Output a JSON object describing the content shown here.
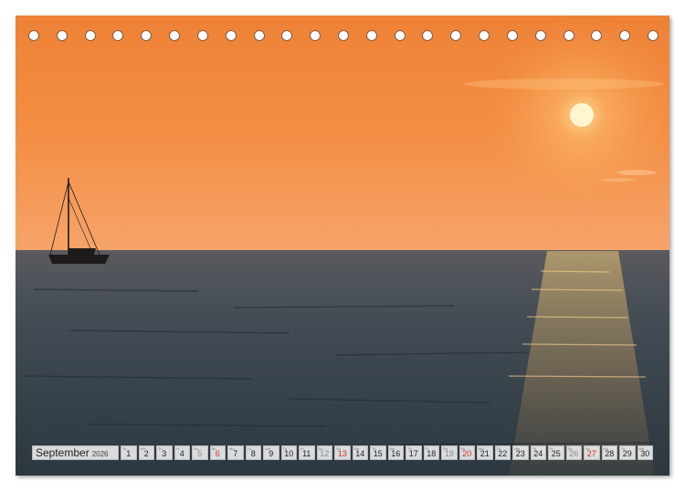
{
  "calendar": {
    "month": "September",
    "year": "2026",
    "days": [
      {
        "n": "1",
        "wd": "Tu",
        "type": "weekday"
      },
      {
        "n": "2",
        "wd": "We",
        "type": "weekday"
      },
      {
        "n": "3",
        "wd": "Th",
        "type": "weekday"
      },
      {
        "n": "4",
        "wd": "Fr",
        "type": "weekday"
      },
      {
        "n": "5",
        "wd": "Sa",
        "type": "sat"
      },
      {
        "n": "6",
        "wd": "Su",
        "type": "sun"
      },
      {
        "n": "7",
        "wd": "Mo",
        "type": "weekday"
      },
      {
        "n": "8",
        "wd": "Tu",
        "type": "weekday"
      },
      {
        "n": "9",
        "wd": "We",
        "type": "weekday"
      },
      {
        "n": "10",
        "wd": "Th",
        "type": "weekday"
      },
      {
        "n": "11",
        "wd": "Fr",
        "type": "weekday"
      },
      {
        "n": "12",
        "wd": "Sa",
        "type": "sat"
      },
      {
        "n": "13",
        "wd": "Su",
        "type": "sun"
      },
      {
        "n": "14",
        "wd": "Mo",
        "type": "weekday"
      },
      {
        "n": "15",
        "wd": "Tu",
        "type": "weekday"
      },
      {
        "n": "16",
        "wd": "We",
        "type": "weekday"
      },
      {
        "n": "17",
        "wd": "Th",
        "type": "weekday"
      },
      {
        "n": "18",
        "wd": "Fr",
        "type": "weekday"
      },
      {
        "n": "19",
        "wd": "Sa",
        "type": "sat"
      },
      {
        "n": "20",
        "wd": "Su",
        "type": "sun"
      },
      {
        "n": "21",
        "wd": "Mo",
        "type": "weekday"
      },
      {
        "n": "22",
        "wd": "Tu",
        "type": "weekday"
      },
      {
        "n": "23",
        "wd": "We",
        "type": "weekday"
      },
      {
        "n": "24",
        "wd": "Th",
        "type": "weekday"
      },
      {
        "n": "25",
        "wd": "Fr",
        "type": "weekday"
      },
      {
        "n": "26",
        "wd": "Sa",
        "type": "sat"
      },
      {
        "n": "27",
        "wd": "Su",
        "type": "sun"
      },
      {
        "n": "28",
        "wd": "Mo",
        "type": "weekday"
      },
      {
        "n": "29",
        "wd": "Tu",
        "type": "weekday"
      },
      {
        "n": "30",
        "wd": "We",
        "type": "weekday"
      }
    ]
  },
  "binding_holes": 23,
  "colors": {
    "sky_top": "#f0883a",
    "sky_bottom": "#f49a58",
    "sea": "#3e4a52",
    "sun": "#fff6d0",
    "sunday": "#d0302a"
  },
  "icons": [
    "sailboat-silhouette",
    "sun"
  ]
}
